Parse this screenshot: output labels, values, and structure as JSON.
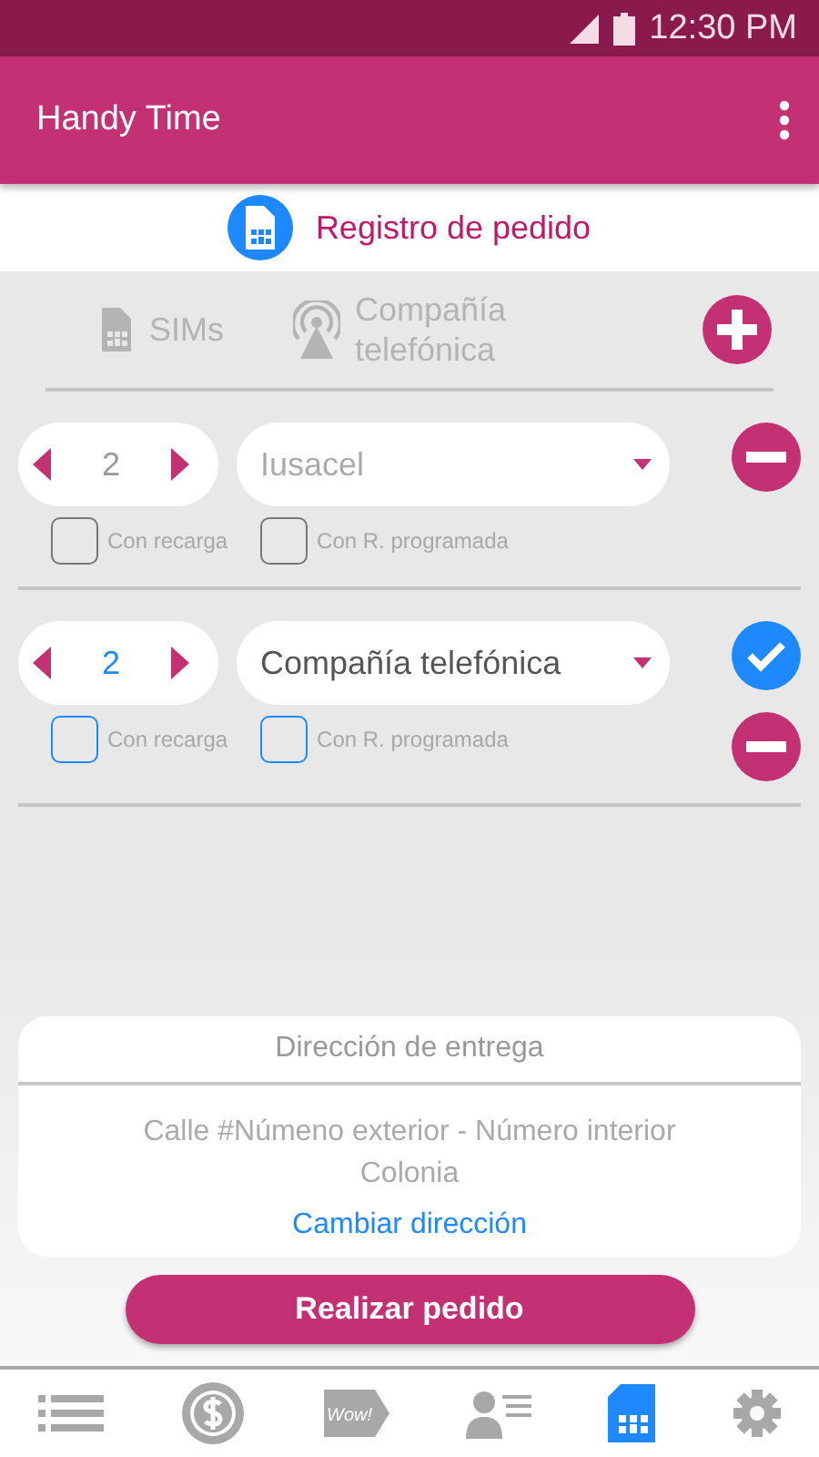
{
  "status_bar": {
    "time": "12:30 PM"
  },
  "app_bar": {
    "title": "Handy Time"
  },
  "page_title": "Registro de pedido",
  "header": {
    "sims_label": "SIMs",
    "company_label": "Compañía\ntelefónica"
  },
  "rows": [
    {
      "quantity": "2",
      "company": "Iusacel",
      "active": false,
      "recarga": {
        "label": "Con recarga",
        "checked": false
      },
      "programada": {
        "label": "Con R. programada",
        "checked": false
      }
    },
    {
      "quantity": "2",
      "company": "Compañía telefónica",
      "active": true,
      "recarga": {
        "label": "Con recarga",
        "checked": false
      },
      "programada": {
        "label": "Con R. programada",
        "checked": false
      }
    }
  ],
  "delivery": {
    "title": "Dirección de entrega",
    "address": "Calle #Númeno exterior - Número interior\nColonia",
    "link": "Cambiar dirección"
  },
  "submit": "Realizar pedido",
  "nav": [
    {
      "kind": "list",
      "selected": false
    },
    {
      "kind": "coin",
      "selected": false
    },
    {
      "kind": "tag",
      "label": "Wow!",
      "selected": false
    },
    {
      "kind": "contacts",
      "selected": false
    },
    {
      "kind": "sim",
      "selected": true
    },
    {
      "kind": "settings",
      "selected": false
    }
  ]
}
